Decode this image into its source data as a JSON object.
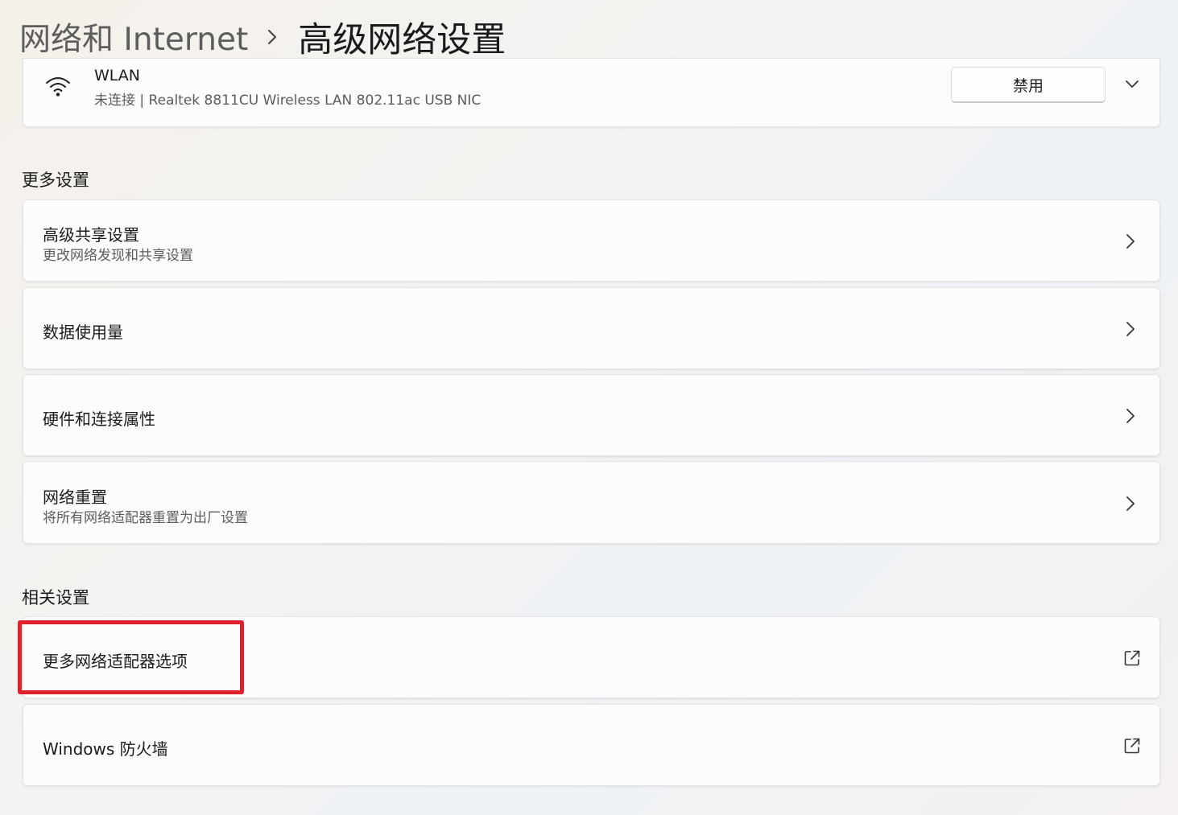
{
  "breadcrumb": {
    "parent": "网络和 Internet",
    "current": "高级网络设置"
  },
  "wlan": {
    "title": "WLAN",
    "status": "未连接 | Realtek 8811CU Wireless LAN 802.11ac USB NIC",
    "disable_label": "禁用"
  },
  "more_settings": {
    "heading": "更多设置",
    "items": [
      {
        "title": "高级共享设置",
        "subtitle": "更改网络发现和共享设置"
      },
      {
        "title": "数据使用量"
      },
      {
        "title": "硬件和连接属性"
      },
      {
        "title": "网络重置",
        "subtitle": "将所有网络适配器重置为出厂设置"
      }
    ]
  },
  "related_settings": {
    "heading": "相关设置",
    "items": [
      {
        "title": "更多网络适配器选项"
      },
      {
        "title": "Windows 防火墙"
      }
    ]
  },
  "colors": {
    "highlight": "#e0202a",
    "text_primary": "#1b1b1b",
    "text_secondary": "#5c5c5c"
  },
  "icons": [
    "wifi-icon",
    "chevron-right-icon",
    "chevron-down-icon",
    "external-link-icon"
  ]
}
